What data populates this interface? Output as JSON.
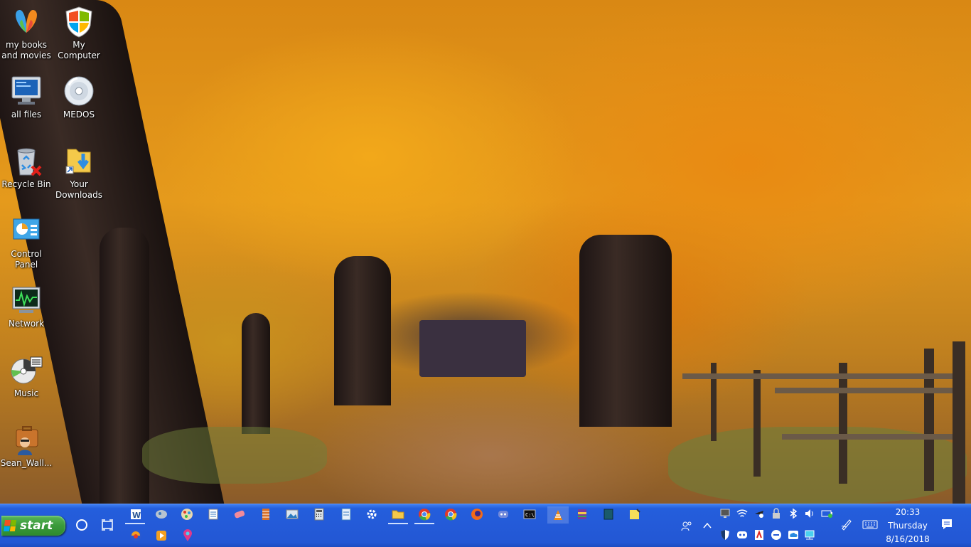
{
  "desktop": {
    "icons": [
      {
        "label": "my books and movies"
      },
      {
        "label": "My Computer"
      },
      {
        "label": "all files"
      },
      {
        "label": "MEDOS"
      },
      {
        "label": "Recycle Bin"
      },
      {
        "label": "Your Downloads"
      },
      {
        "label": "Control Panel"
      },
      {
        "label": "Network"
      },
      {
        "label": "Music"
      },
      {
        "label": "Sean_Wall..."
      }
    ]
  },
  "taskbar": {
    "start_label": "start",
    "pinned_apps": [
      "word-icon",
      "messenger-icon",
      "paint-icon",
      "notepad-icon",
      "eraser-icon",
      "archive-icon",
      "photos-icon",
      "calculator-icon",
      "notes-icon",
      "settings-icon",
      "file-explorer-icon",
      "chrome-icon",
      "chrome-alt-icon",
      "firefox-icon",
      "discord-icon",
      "command-prompt-icon",
      "vlc-icon",
      "winrar-icon",
      "book-icon",
      "sticky-notes-icon",
      "music-app-icon",
      "media-player-icon",
      "maps-icon"
    ],
    "tray_icons": [
      "people-icon",
      "show-hidden-icons",
      "display-icon",
      "wifi-icon",
      "pirate-icon",
      "lock-icon",
      "bluetooth-icon",
      "volume-icon",
      "battery-icon",
      "pen-icon",
      "keyboard-icon",
      "shield-icon",
      "discord-tray-icon",
      "adobe-icon",
      "minus-icon",
      "cloud-icon",
      "network-drive-icon"
    ],
    "clock": {
      "time": "20:33",
      "day": "Thursday",
      "date": "8/16/2018"
    },
    "notification_icon": "action-center-icon"
  }
}
